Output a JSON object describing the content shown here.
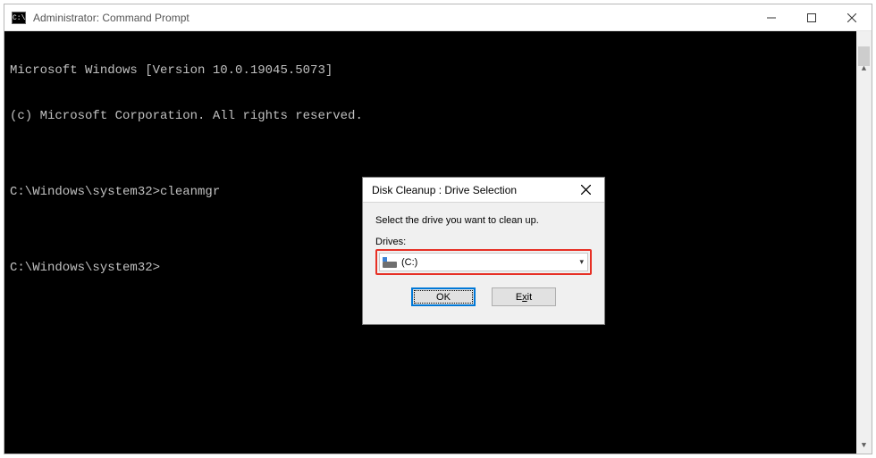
{
  "cmd": {
    "title": "Administrator: Command Prompt",
    "icon_text": "C:\\.",
    "lines": [
      "Microsoft Windows [Version 10.0.19045.5073]",
      "(c) Microsoft Corporation. All rights reserved.",
      "",
      "C:\\Windows\\system32>cleanmgr",
      "",
      "C:\\Windows\\system32>"
    ]
  },
  "dialog": {
    "title": "Disk Cleanup : Drive Selection",
    "instruction": "Select the drive you want to clean up.",
    "drives_label": "Drives:",
    "selected_drive": " (C:)",
    "ok_label": "OK",
    "exit_label_pre": "E",
    "exit_label_under": "x",
    "exit_label_post": "it"
  }
}
